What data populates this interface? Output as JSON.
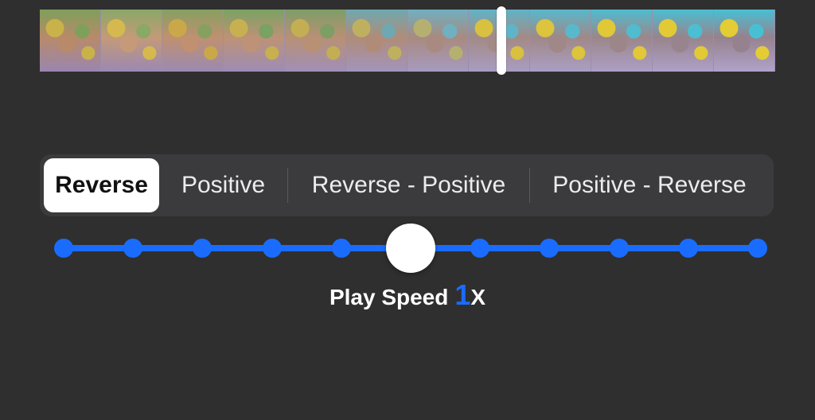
{
  "filmstrip": {
    "frame_count": 12,
    "playhead_fraction": 0.627
  },
  "segments": {
    "selected_index": 0,
    "items": [
      {
        "label": "Reverse"
      },
      {
        "label": "Positive"
      },
      {
        "label": "Reverse - Positive"
      },
      {
        "label": "Positive - Reverse"
      }
    ]
  },
  "slider": {
    "step_count": 11,
    "selected_step": 5,
    "accent_color": "#1a6cff"
  },
  "speed": {
    "label": "Play Speed",
    "value": "1",
    "unit": "X"
  }
}
